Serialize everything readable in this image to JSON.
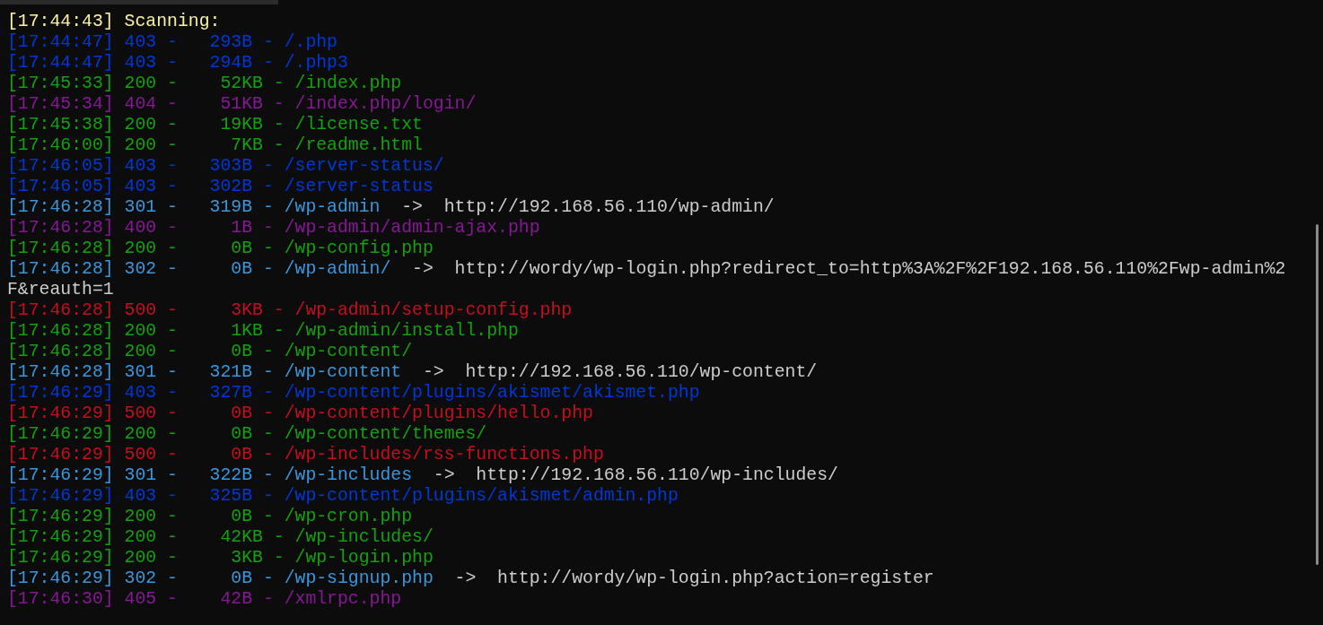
{
  "header": "[17:44:43] Scanning:",
  "lines": [
    {
      "text": "[17:44:47] 403 -   293B - /.php",
      "kind": "forbidden"
    },
    {
      "text": "[17:44:47] 403 -   294B - /.php3",
      "kind": "forbidden"
    },
    {
      "text": "[17:45:33] 200 -    52KB - /index.php",
      "kind": "ok"
    },
    {
      "text": "[17:45:34] 404 -    51KB - /index.php/login/",
      "kind": "client_error"
    },
    {
      "text": "[17:45:38] 200 -    19KB - /license.txt",
      "kind": "ok"
    },
    {
      "text": "[17:46:00] 200 -     7KB - /readme.html",
      "kind": "ok"
    },
    {
      "text": "[17:46:05] 403 -   303B - /server-status/",
      "kind": "forbidden"
    },
    {
      "text": "[17:46:05] 403 -   302B - /server-status",
      "kind": "forbidden"
    },
    {
      "text": "[17:46:28] 301 -   319B - /wp-admin",
      "kind": "redirect",
      "arrow": "->",
      "target": "http://192.168.56.110/wp-admin/"
    },
    {
      "text": "[17:46:28] 400 -     1B - /wp-admin/admin-ajax.php",
      "kind": "client_error"
    },
    {
      "text": "[17:46:28] 200 -     0B - /wp-config.php",
      "kind": "ok"
    },
    {
      "text": "[17:46:28] 302 -     0B - /wp-admin/",
      "kind": "redirect",
      "arrow": "->",
      "target": "http://wordy/wp-login.php?redirect_to=http%3A%2F%2F192.168.56.110%2Fwp-admin%2",
      "continuation": "F&reauth=1"
    },
    {
      "text": "[17:46:28] 500 -     3KB - /wp-admin/setup-config.php",
      "kind": "server_error"
    },
    {
      "text": "[17:46:28] 200 -     1KB - /wp-admin/install.php",
      "kind": "ok"
    },
    {
      "text": "[17:46:28] 200 -     0B - /wp-content/",
      "kind": "ok"
    },
    {
      "text": "[17:46:28] 301 -   321B - /wp-content",
      "kind": "redirect",
      "arrow": "->",
      "target": "http://192.168.56.110/wp-content/"
    },
    {
      "text": "[17:46:29] 403 -   327B - /wp-content/plugins/akismet/akismet.php",
      "kind": "forbidden"
    },
    {
      "text": "[17:46:29] 500 -     0B - /wp-content/plugins/hello.php",
      "kind": "server_error"
    },
    {
      "text": "[17:46:29] 200 -     0B - /wp-content/themes/",
      "kind": "ok"
    },
    {
      "text": "[17:46:29] 500 -     0B - /wp-includes/rss-functions.php",
      "kind": "server_error"
    },
    {
      "text": "[17:46:29] 301 -   322B - /wp-includes",
      "kind": "redirect",
      "arrow": "->",
      "target": "http://192.168.56.110/wp-includes/"
    },
    {
      "text": "[17:46:29] 403 -   325B - /wp-content/plugins/akismet/admin.php",
      "kind": "forbidden"
    },
    {
      "text": "[17:46:29] 200 -     0B - /wp-cron.php",
      "kind": "ok"
    },
    {
      "text": "[17:46:29] 200 -    42KB - /wp-includes/",
      "kind": "ok"
    },
    {
      "text": "[17:46:29] 200 -     3KB - /wp-login.php",
      "kind": "ok"
    },
    {
      "text": "[17:46:29] 302 -     0B - /wp-signup.php",
      "kind": "redirect",
      "arrow": "->",
      "target": "http://wordy/wp-login.php?action=register"
    },
    {
      "text": "[17:46:30] 405 -    42B - /xmlrpc.php",
      "kind": "client_error"
    }
  ]
}
